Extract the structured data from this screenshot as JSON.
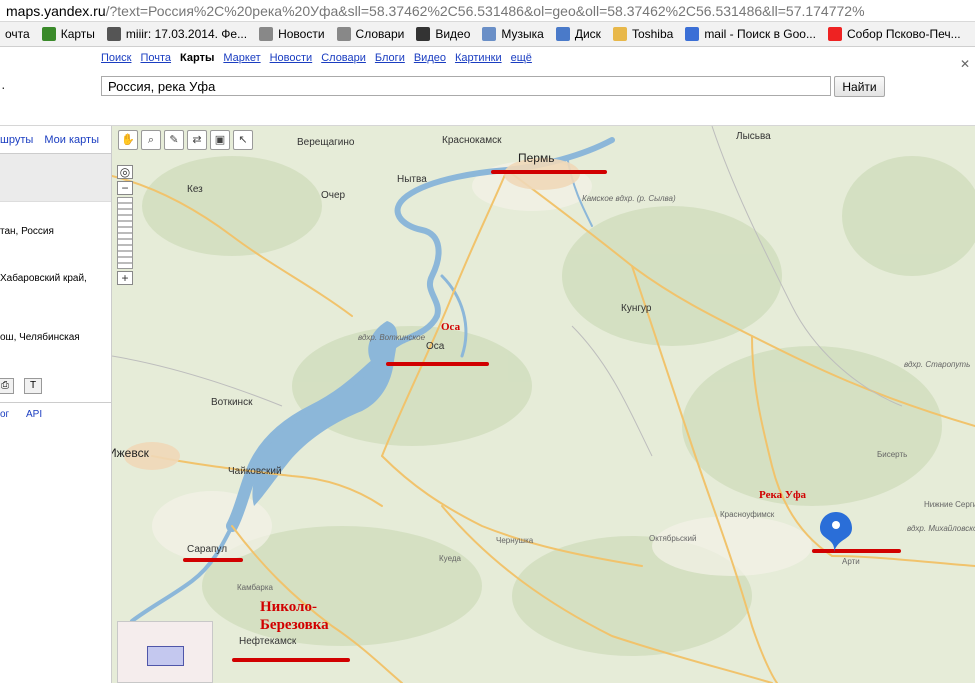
{
  "browser": {
    "address_host": "maps.yandex.ru",
    "address_rest": "/?text=Россия%2C%20река%20Уфа&sll=58.37462%2C56.531486&ol=geo&oll=58.37462%2C56.531486&ll=57.174772%",
    "bookmarks": [
      {
        "label": "очта",
        "icon": "mail-icon",
        "color": "#c43"
      },
      {
        "label": "Карты",
        "icon": "maps-icon",
        "color": "#3a8a2a"
      },
      {
        "label": "miiir: 17.03.2014. Фе...",
        "icon": "user-icon",
        "color": "#555"
      },
      {
        "label": "Новости",
        "icon": "page-icon",
        "color": "#888"
      },
      {
        "label": "Словари",
        "icon": "page-icon",
        "color": "#888"
      },
      {
        "label": "Видео",
        "icon": "video-icon",
        "color": "#333"
      },
      {
        "label": "Музыка",
        "icon": "music-icon",
        "color": "#6a8fc7"
      },
      {
        "label": "Диск",
        "icon": "disk-icon",
        "color": "#4a7ac9"
      },
      {
        "label": "Toshiba",
        "icon": "folder-icon",
        "color": "#e8b84a"
      },
      {
        "label": "mail - Поиск в Goo...",
        "icon": "google-icon",
        "color": "#3b6fd6"
      },
      {
        "label": "Собор Псково-Печ...",
        "icon": "yandex-icon",
        "color": "#e22"
      }
    ]
  },
  "yandex": {
    "services": [
      "Поиск",
      "Почта",
      "Карты",
      "Маркет",
      "Новости",
      "Словари",
      "Блоги",
      "Видео",
      "Картинки",
      "ещё"
    ],
    "active_service": "Карты",
    "search_value": "Россия, река Уфа",
    "find_label": "Найти"
  },
  "left_panel": {
    "tab_routes": "шруты",
    "tab_my_maps": "Мои карты",
    "results": [
      "тан, Россия",
      "Хабаровский край,",
      "ош, Челябинская"
    ],
    "links": [
      "ог",
      "API"
    ]
  },
  "map": {
    "cities": [
      {
        "name": "Пермь",
        "size": "big"
      },
      {
        "name": "Краснокамск",
        "size": "normal"
      },
      {
        "name": "Верещагино",
        "size": "normal"
      },
      {
        "name": "Лысьва",
        "size": "normal"
      },
      {
        "name": "Нытва",
        "size": "normal"
      },
      {
        "name": "Очер",
        "size": "normal"
      },
      {
        "name": "Кез",
        "size": "normal"
      },
      {
        "name": "Оса",
        "size": "normal"
      },
      {
        "name": "Кунгур",
        "size": "normal"
      },
      {
        "name": "Воткинск",
        "size": "normal"
      },
      {
        "name": "Ижевск",
        "size": "big"
      },
      {
        "name": "Чайковский",
        "size": "normal"
      },
      {
        "name": "Сарапул",
        "size": "normal"
      },
      {
        "name": "Нефтекамск",
        "size": "normal"
      },
      {
        "name": "Чернушка",
        "size": "normal"
      },
      {
        "name": "Октябрьский",
        "size": "normal"
      },
      {
        "name": "Красноуфимск",
        "size": "normal"
      },
      {
        "name": "Арти",
        "size": "normal"
      },
      {
        "name": "Бисерть",
        "size": "normal"
      },
      {
        "name": "Куеда",
        "size": "normal"
      },
      {
        "name": "Камбарка",
        "size": "normal"
      },
      {
        "name": "Нижние Серги",
        "size": "normal"
      }
    ],
    "water_labels": [
      "вдхр. Воткинское",
      "Камское вдхр. (р. Сылва)",
      "вдхр. Старопуть",
      "вдхр. Михайловское"
    ],
    "annotations": {
      "osa": "Оса",
      "river_ufa": "Река Уфа",
      "nikolo": "Николо-",
      "berezovka": "Березовка"
    },
    "tools": [
      "hand-icon",
      "magnifier-icon",
      "ruler-icon",
      "route-icon",
      "layers-icon",
      "cursor-icon"
    ],
    "colors": {
      "water": "#8cb7d9",
      "road": "#f1c36c",
      "annotation": "#d10000",
      "pin": "#2a6ed8"
    }
  }
}
